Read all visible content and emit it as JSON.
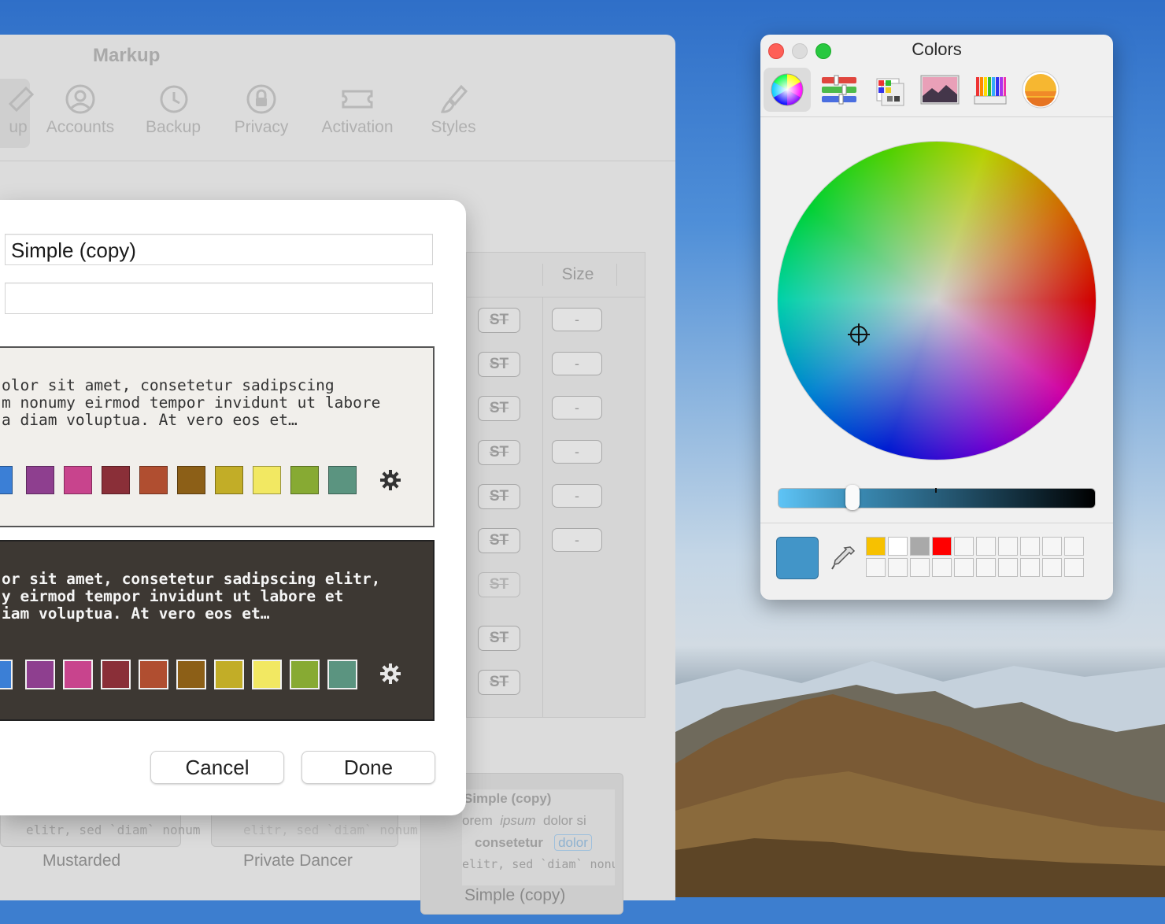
{
  "prefs": {
    "title": "Markup",
    "toolbar": [
      {
        "label": "up"
      },
      {
        "label": "Accounts"
      },
      {
        "label": "Backup"
      },
      {
        "label": "Privacy"
      },
      {
        "label": "Activation"
      },
      {
        "label": "Styles"
      }
    ],
    "table": {
      "size_header": "Size",
      "st_label": "ST",
      "dash_label": "-"
    },
    "themes": [
      {
        "name": "Mustarded",
        "preview_line": "elitr, sed `diam` nonum"
      },
      {
        "name": "Private Dancer",
        "preview_line": "elitr, sed `diam` nonum"
      },
      {
        "name": "Simple (copy)",
        "line1": "Simple (copy)",
        "line2a": "orem",
        "line2b": "ipsum",
        "line2c": "dolor si",
        "line3a": "consetetur",
        "line3b": "dolor",
        "line4": "elitr, sed `diam` nonum"
      }
    ]
  },
  "sheet": {
    "name_value": "Simple (copy)",
    "second_field_value": "",
    "light_preview": "olor sit amet, consetetur sadipscing\nm nonumy eirmod tempor invidunt ut labore\na diam voluptua. At vero eos et…",
    "dark_preview": "or sit amet, consetetur sadipscing elitr,\ny eirmod tempor invidunt ut labore et\niam voluptua. At vero eos et…",
    "swatch_colors": [
      "#3b7fd6",
      "#8e3f8f",
      "#c8448d",
      "#8a2f38",
      "#b04e30",
      "#8c5f17",
      "#c2ad27",
      "#f2e862",
      "#87aa33",
      "#5b9480"
    ],
    "cancel": "Cancel",
    "done": "Done"
  },
  "colors_panel": {
    "title": "Colors",
    "tabs": [
      "color-wheel",
      "color-sliders",
      "color-palettes",
      "image-palettes",
      "pencils",
      "crayons"
    ],
    "selected_tab": "color-wheel",
    "current_color": "#4295c8",
    "brightness_percent": 75,
    "palette_filled": [
      "#f7c100",
      "#ffffff",
      "#a9a9a9",
      "#ff0000"
    ]
  }
}
